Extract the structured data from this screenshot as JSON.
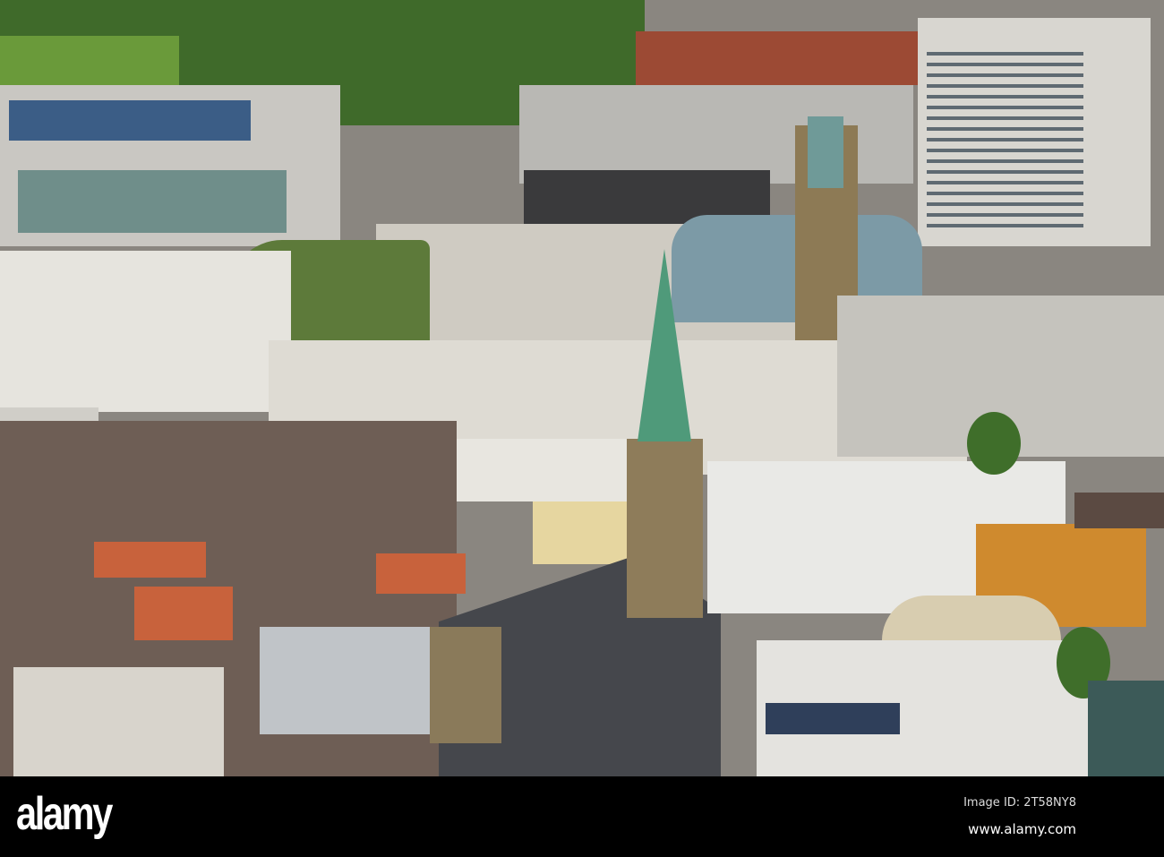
{
  "watermark": {
    "logo": "alamy",
    "image_id": "Image ID: 2T58NY8",
    "url": "www.alamy.com"
  }
}
